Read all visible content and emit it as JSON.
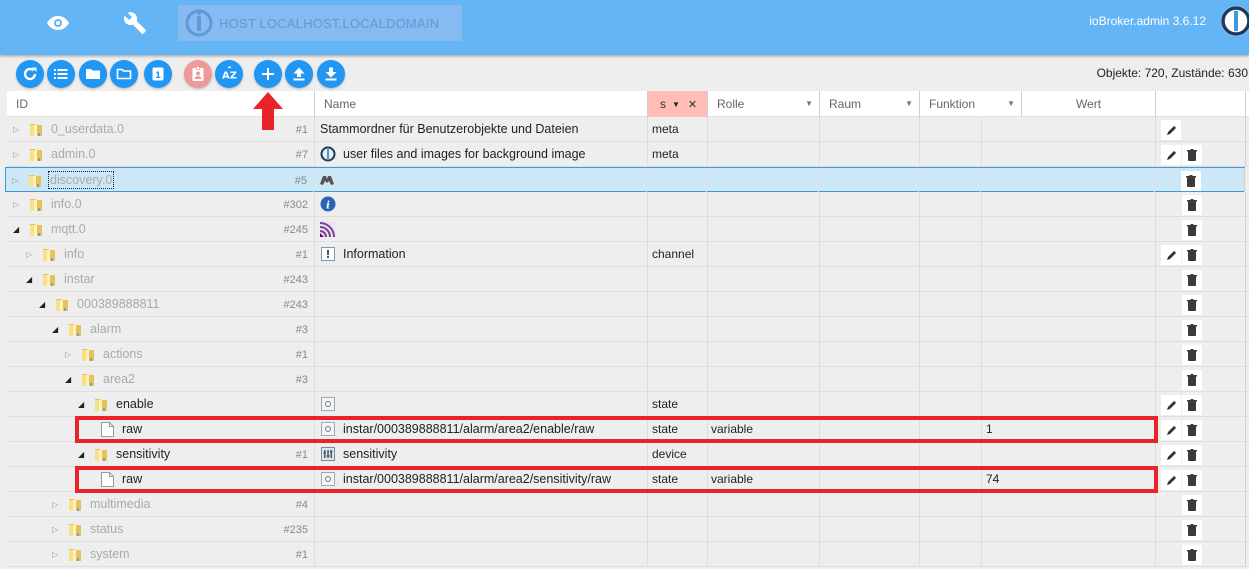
{
  "header": {
    "host_label": "HOST LOCALHOST.LOCALDOMAIN",
    "app_version": "ioBroker.admin 3.6.12",
    "nav_icons": [
      "eye-icon",
      "wrench-icon"
    ]
  },
  "toolbar": {
    "buttons": [
      {
        "name": "refresh-button",
        "icon": "refresh-icon"
      },
      {
        "name": "list-view-button",
        "icon": "list-icon"
      },
      {
        "name": "collapse-all-button",
        "icon": "folder-filled-icon"
      },
      {
        "name": "expand-all-button",
        "icon": "folder-outline-icon"
      },
      {
        "name": "level-button",
        "icon": "number-one-icon",
        "label": "1"
      },
      {
        "name": "show-system-button",
        "icon": "badge-icon"
      },
      {
        "name": "sort-az-button",
        "icon": "sort-az-icon",
        "label": "AZ"
      },
      {
        "name": "add-object-button",
        "icon": "plus-icon"
      },
      {
        "name": "upload-button",
        "icon": "upload-icon"
      },
      {
        "name": "download-button",
        "icon": "download-icon"
      }
    ],
    "counts": "Objekte: 720, Zustände: 630"
  },
  "table": {
    "columns": {
      "id": "ID",
      "name": "Name",
      "type_filter": "s",
      "role": "Rolle",
      "room": "Raum",
      "function": "Funktion",
      "value": "Wert"
    },
    "rows": [
      {
        "id": "0_userdata.0",
        "count": "#1",
        "name": "Stammordner für Benutzerobjekte und Dateien",
        "name_icon": "",
        "type": "meta",
        "role": "",
        "value": "",
        "edit": true,
        "delete": false,
        "expanded": false
      },
      {
        "id": "admin.0",
        "count": "#7",
        "name": "user files and images for background image",
        "name_icon": "iobroker-logo-icon",
        "type": "meta",
        "role": "",
        "value": "",
        "edit": true,
        "delete": true,
        "expanded": false
      },
      {
        "id": "discovery.0",
        "count": "#5",
        "name": "",
        "name_icon": "binoculars-icon",
        "type": "",
        "role": "",
        "value": "",
        "edit": false,
        "delete": true,
        "expanded": false,
        "selected": true
      },
      {
        "id": "info.0",
        "count": "#302",
        "name": "",
        "name_icon": "info-circle-icon",
        "type": "",
        "role": "",
        "value": "",
        "edit": false,
        "delete": true,
        "expanded": false
      },
      {
        "id": "mqtt.0",
        "count": "#245",
        "name": "",
        "name_icon": "mqtt-icon",
        "type": "",
        "role": "",
        "value": "",
        "edit": false,
        "delete": true,
        "expanded": true
      },
      {
        "id": "info",
        "count": "#1",
        "name": "Information",
        "name_icon": "channel-icon",
        "type": "channel",
        "role": "",
        "value": "",
        "edit": true,
        "delete": true,
        "expanded": false
      },
      {
        "id": "instar",
        "count": "#243",
        "name": "",
        "name_icon": "",
        "type": "",
        "role": "",
        "value": "",
        "edit": false,
        "delete": true,
        "expanded": true
      },
      {
        "id": "000389888811",
        "count": "#243",
        "name": "",
        "name_icon": "",
        "type": "",
        "role": "",
        "value": "",
        "edit": false,
        "delete": true,
        "expanded": true
      },
      {
        "id": "alarm",
        "count": "#3",
        "name": "",
        "name_icon": "",
        "type": "",
        "role": "",
        "value": "",
        "edit": false,
        "delete": true,
        "expanded": true
      },
      {
        "id": "actions",
        "count": "#1",
        "name": "",
        "name_icon": "",
        "type": "",
        "role": "",
        "value": "",
        "edit": false,
        "delete": true,
        "expanded": false
      },
      {
        "id": "area2",
        "count": "#3",
        "name": "",
        "name_icon": "",
        "type": "",
        "role": "",
        "value": "",
        "edit": false,
        "delete": true,
        "expanded": true
      },
      {
        "id": "enable",
        "count": "",
        "name": "",
        "name_icon": "state-icon",
        "type": "state",
        "role": "",
        "value": "",
        "edit": true,
        "delete": true,
        "expanded": true
      },
      {
        "id": "raw",
        "count": "",
        "name": "instar/000389888811/alarm/area2/enable/raw",
        "name_icon": "state-icon",
        "type": "state",
        "role": "variable",
        "value": "1",
        "edit": true,
        "delete": true,
        "highlighted": true
      },
      {
        "id": "sensitivity",
        "count": "#1",
        "name": "sensitivity",
        "name_icon": "device-icon",
        "type": "device",
        "role": "",
        "value": "",
        "edit": true,
        "delete": true,
        "expanded": true
      },
      {
        "id": "raw",
        "count": "",
        "name": "instar/000389888811/alarm/area2/sensitivity/raw",
        "name_icon": "state-icon",
        "type": "state",
        "role": "variable",
        "value": "74",
        "edit": true,
        "delete": true,
        "highlighted": true
      },
      {
        "id": "multimedia",
        "count": "#4",
        "name": "",
        "name_icon": "",
        "type": "",
        "role": "",
        "value": "",
        "edit": false,
        "delete": true,
        "expanded": false
      },
      {
        "id": "status",
        "count": "#235",
        "name": "",
        "name_icon": "",
        "type": "",
        "role": "",
        "value": "",
        "edit": false,
        "delete": true,
        "expanded": false
      },
      {
        "id": "system",
        "count": "#1",
        "name": "",
        "name_icon": "",
        "type": "",
        "role": "",
        "value": "",
        "edit": false,
        "delete": true,
        "expanded": false
      }
    ]
  },
  "annotations": {
    "arrow_color": "#e8232a",
    "highlight_color": "#e8232a"
  }
}
